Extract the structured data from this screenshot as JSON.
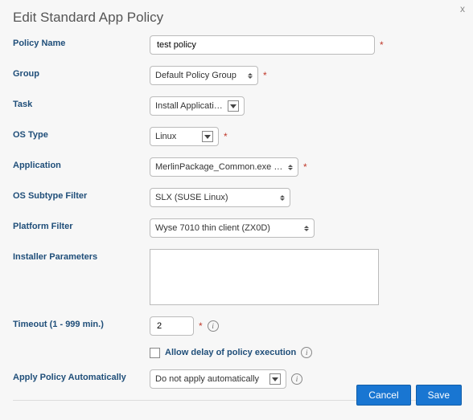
{
  "dialog": {
    "title": "Edit Standard App Policy"
  },
  "labels": {
    "policyName": "Policy Name",
    "group": "Group",
    "task": "Task",
    "osType": "OS Type",
    "application": "Application",
    "osSubtype": "OS Subtype Filter",
    "platformFilter": "Platform Filter",
    "installerParams": "Installer Parameters",
    "timeout": "Timeout (1 - 999 min.)",
    "allowDelay": "Allow delay of policy execution",
    "applyAuto": "Apply Policy Automatically"
  },
  "values": {
    "policyName": "test policy",
    "group": "Default Policy Group",
    "task": "Install Application",
    "osType": "Linux",
    "application": "MerlinPackage_Common.exe (Loc",
    "osSubtype": "SLX (SUSE Linux)",
    "platformFilter": "Wyse 7010 thin client (ZX0D)",
    "installerParams": "",
    "timeout": "2",
    "applyAuto": "Do not apply automatically"
  },
  "buttons": {
    "cancel": "Cancel",
    "save": "Save"
  }
}
